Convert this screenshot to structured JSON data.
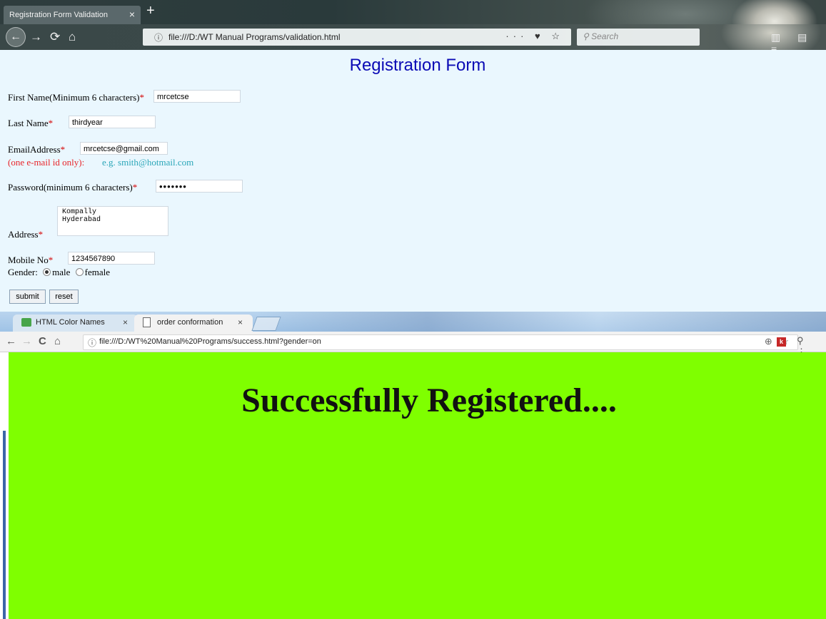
{
  "top_browser": {
    "tab_title": "Registration Form Validation",
    "tab_close": "×",
    "new_tab": "+",
    "url": "file:///D:/WT Manual Programs/validation.html",
    "url_actions": "··· ♥ ☆",
    "search_placeholder": "Search",
    "nav_icons": {
      "back": "←",
      "forward": "→",
      "reload": "⟳",
      "home": "⌂"
    }
  },
  "form": {
    "title": "Registration Form",
    "first_name_label": "First Name(Minimum 6 characters)",
    "first_name_value": "mrcetcse",
    "last_name_label": "Last Name",
    "last_name_value": "thirdyear",
    "email_label": "EmailAddress",
    "email_value": "mrcetcse@gmail.com",
    "email_hint": "(one e-mail id only):",
    "email_example": "e.g. smith@hotmail.com",
    "password_label": "Password(minimum 6 characters)",
    "password_value": "•••••••",
    "address_label": "Address",
    "address_lines": [
      "Kompally",
      "Hyderabad"
    ],
    "mobile_label": "Mobile No",
    "mobile_value": "1234567890",
    "gender_label": "Gender:",
    "gender_options": [
      "male",
      "female"
    ],
    "gender_selected": "male",
    "required_marker": "*",
    "submit_label": "submit",
    "reset_label": "reset"
  },
  "bottom_browser": {
    "tabs": [
      {
        "title": "HTML Color Names",
        "close": "×"
      },
      {
        "title": "order conformation",
        "close": "×"
      }
    ],
    "url": "file:///D:/WT%20Manual%20Programs/success.html?gender=on",
    "nav_icons": {
      "back": "←",
      "forward": "→",
      "reload": "C",
      "home": "⌂"
    },
    "right_icons": {
      "zoom": "⊕ ☆",
      "extension": "k",
      "menu": "⚲ ⋮"
    }
  },
  "success_page": {
    "message": "Successfully Registered....",
    "background_color": "#7fff00"
  },
  "colors": {
    "form_title": "#0b0bb5",
    "required": "#d40000",
    "hint_red": "#e8262a",
    "hint_teal": "#2aa6b8",
    "form_background": "#eaf7fe"
  }
}
